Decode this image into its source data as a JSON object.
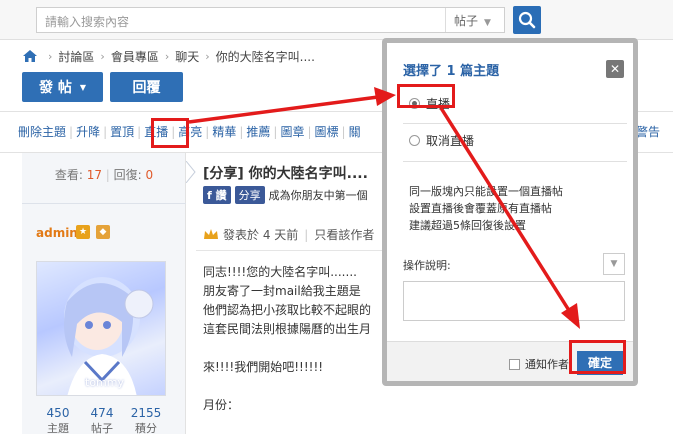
{
  "search": {
    "placeholder": "請輸入搜索內容",
    "type_label": "帖子"
  },
  "breadcrumb": {
    "items": [
      "討論區",
      "會員專區",
      "聊天",
      "你的大陸名字叫...."
    ]
  },
  "actions": {
    "post_label": "發 帖",
    "reply_label": "回覆"
  },
  "mod_toolbar": {
    "items": [
      "刪除主題",
      "升降",
      "置頂",
      "直播",
      "高亮",
      "精華",
      "推薦",
      "圖章",
      "圖標",
      "關"
    ],
    "right_item": "警告"
  },
  "thread": {
    "views_label": "查看:",
    "views": "17",
    "replies_label": "回復:",
    "replies": "0",
    "title": "[分享] 你的大陸名字叫....",
    "fb_label": "讚",
    "share_label": "分享",
    "share_text": "成為你朋友中第一個"
  },
  "author": {
    "name": "admin",
    "avatar_caption": "tommy",
    "stats": [
      {
        "value": "450",
        "label": "主題"
      },
      {
        "value": "474",
        "label": "帖子"
      },
      {
        "value": "2155",
        "label": "積分"
      }
    ]
  },
  "post": {
    "meta_posted": "發表於 4 天前",
    "meta_author_only": "只看該作者",
    "lines": [
      "同志!!!!您的大陸名字叫.......",
      "朋友寄了一封mail給我主題是",
      "他們認為把小孩取比較不起眼的",
      "這套民間法則根據陽曆的出生月",
      "",
      "來!!!!我們開始吧!!!!!!",
      "",
      "月份："
    ]
  },
  "modal": {
    "title": "選擇了 1 篇主題",
    "option_live": "直播",
    "option_cancel_live": "取消直播",
    "note_lines": [
      "同一版塊內只能設置一個直播帖",
      "設置直播後會覆蓋原有直播帖",
      "建議超過5條回復後設置"
    ],
    "op_label": "操作說明:",
    "notify_label": "通知作者",
    "confirm_label": "確定"
  },
  "annotation_color": "#e31b1b",
  "brand_color": "#2f6fb5"
}
